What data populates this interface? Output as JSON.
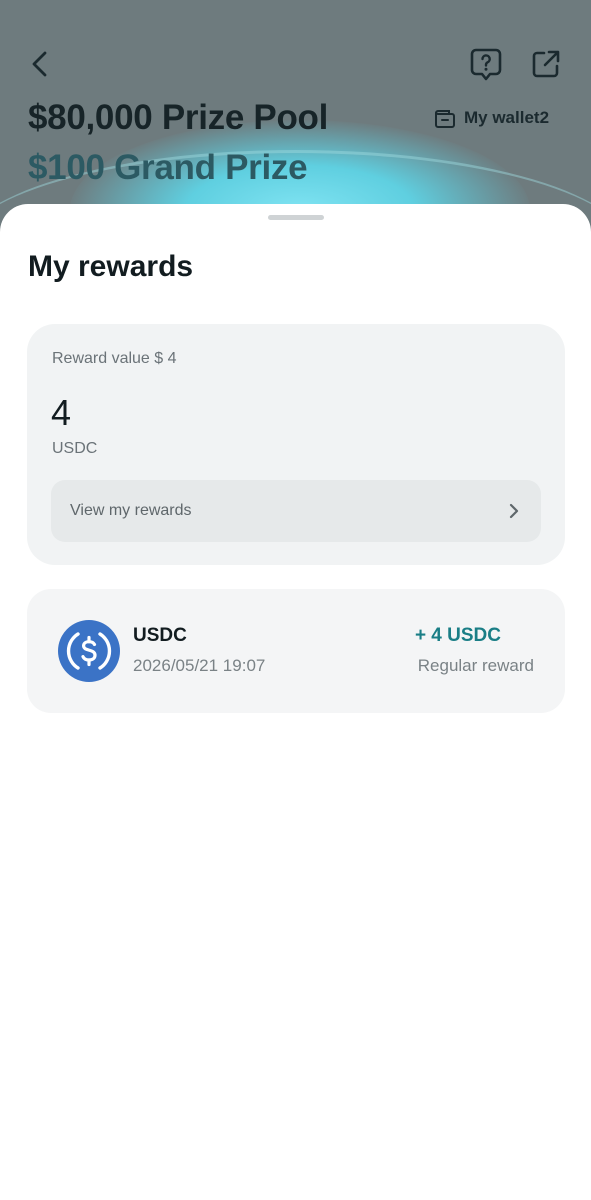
{
  "header": {
    "back_icon": "chevron-left-icon",
    "help_icon": "help-bubble-icon",
    "share_icon": "external-link-icon",
    "wallet_icon": "wallet-icon",
    "wallet_label": "My wallet2",
    "pool_title": "$80,000 Prize Pool",
    "prize_title": "$100 Grand Prize"
  },
  "sheet": {
    "title": "My rewards",
    "reward_card": {
      "value_label": "Reward value $ 4",
      "amount": "4",
      "unit": "USDC",
      "view_label": "View my rewards",
      "view_icon": "chevron-right-icon"
    },
    "history": [
      {
        "coin_icon": "usdc-coin-icon",
        "name": "USDC",
        "date": "2026/05/21 19:07",
        "amount": "+ 4 USDC",
        "type": "Regular reward"
      }
    ]
  },
  "colors": {
    "accent": "#1a7e86",
    "coin_blue": "#3b73c6",
    "backdrop": "#6e7b7e",
    "glow": "#7fe3f2"
  }
}
